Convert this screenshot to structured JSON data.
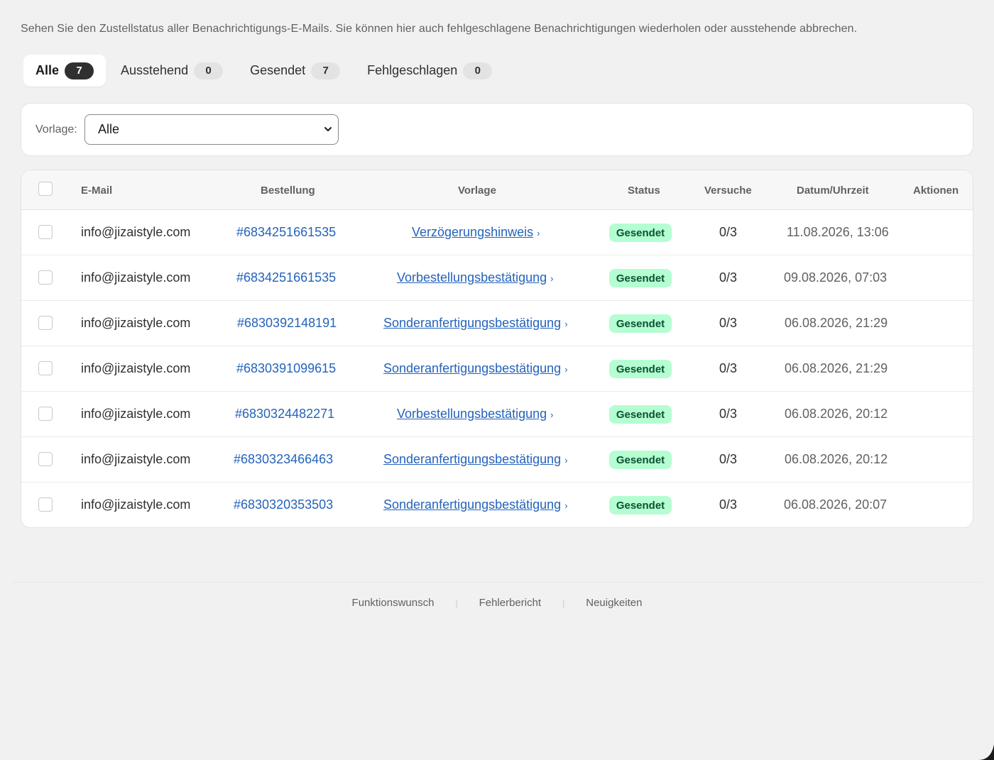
{
  "intro_text": "Sehen Sie den Zustellstatus aller Benachrichtigungs-E-Mails. Sie können hier auch fehlgeschlagene Benachrichtigungen wiederholen oder ausstehende abbrechen.",
  "tabs": [
    {
      "label": "Alle",
      "count": "7",
      "active": true
    },
    {
      "label": "Ausstehend",
      "count": "0",
      "active": false
    },
    {
      "label": "Gesendet",
      "count": "7",
      "active": false
    },
    {
      "label": "Fehlgeschlagen",
      "count": "0",
      "active": false
    }
  ],
  "filter": {
    "label": "Vorlage:",
    "selected": "Alle"
  },
  "table": {
    "headers": {
      "email": "E-Mail",
      "order": "Bestellung",
      "template": "Vorlage",
      "status": "Status",
      "attempts": "Versuche",
      "datetime": "Datum/Uhrzeit",
      "actions": "Aktionen"
    },
    "rows": [
      {
        "email": "info@jizaistyle.com",
        "order": "#6834251661535",
        "template": "Verzögerungshinweis",
        "status": "Gesendet",
        "attempts": "0/3",
        "datetime": "11.08.2026, 13:06"
      },
      {
        "email": "info@jizaistyle.com",
        "order": "#6834251661535",
        "template": "Vorbestellungsbestätigung",
        "status": "Gesendet",
        "attempts": "0/3",
        "datetime": "09.08.2026, 07:03"
      },
      {
        "email": "info@jizaistyle.com",
        "order": "#6830392148191",
        "template": "Sonderanfertigungsbestätigung",
        "status": "Gesendet",
        "attempts": "0/3",
        "datetime": "06.08.2026, 21:29"
      },
      {
        "email": "info@jizaistyle.com",
        "order": "#6830391099615",
        "template": "Sonderanfertigungsbestätigung",
        "status": "Gesendet",
        "attempts": "0/3",
        "datetime": "06.08.2026, 21:29"
      },
      {
        "email": "info@jizaistyle.com",
        "order": "#6830324482271",
        "template": "Vorbestellungsbestätigung",
        "status": "Gesendet",
        "attempts": "0/3",
        "datetime": "06.08.2026, 20:12"
      },
      {
        "email": "info@jizaistyle.com",
        "order": "#6830323466463",
        "template": "Sonderanfertigungsbestätigung",
        "status": "Gesendet",
        "attempts": "0/3",
        "datetime": "06.08.2026, 20:12"
      },
      {
        "email": "info@jizaistyle.com",
        "order": "#6830320353503",
        "template": "Sonderanfertigungsbestätigung",
        "status": "Gesendet",
        "attempts": "0/3",
        "datetime": "06.08.2026, 20:07"
      }
    ]
  },
  "footer": {
    "links": [
      "Funktionswunsch",
      "Fehlerbericht",
      "Neuigkeiten"
    ]
  },
  "colors": {
    "link": "#2463bc",
    "badge_bg": "#b4fed2",
    "badge_text": "#0c5132",
    "page_bg": "#f1f1f1"
  }
}
